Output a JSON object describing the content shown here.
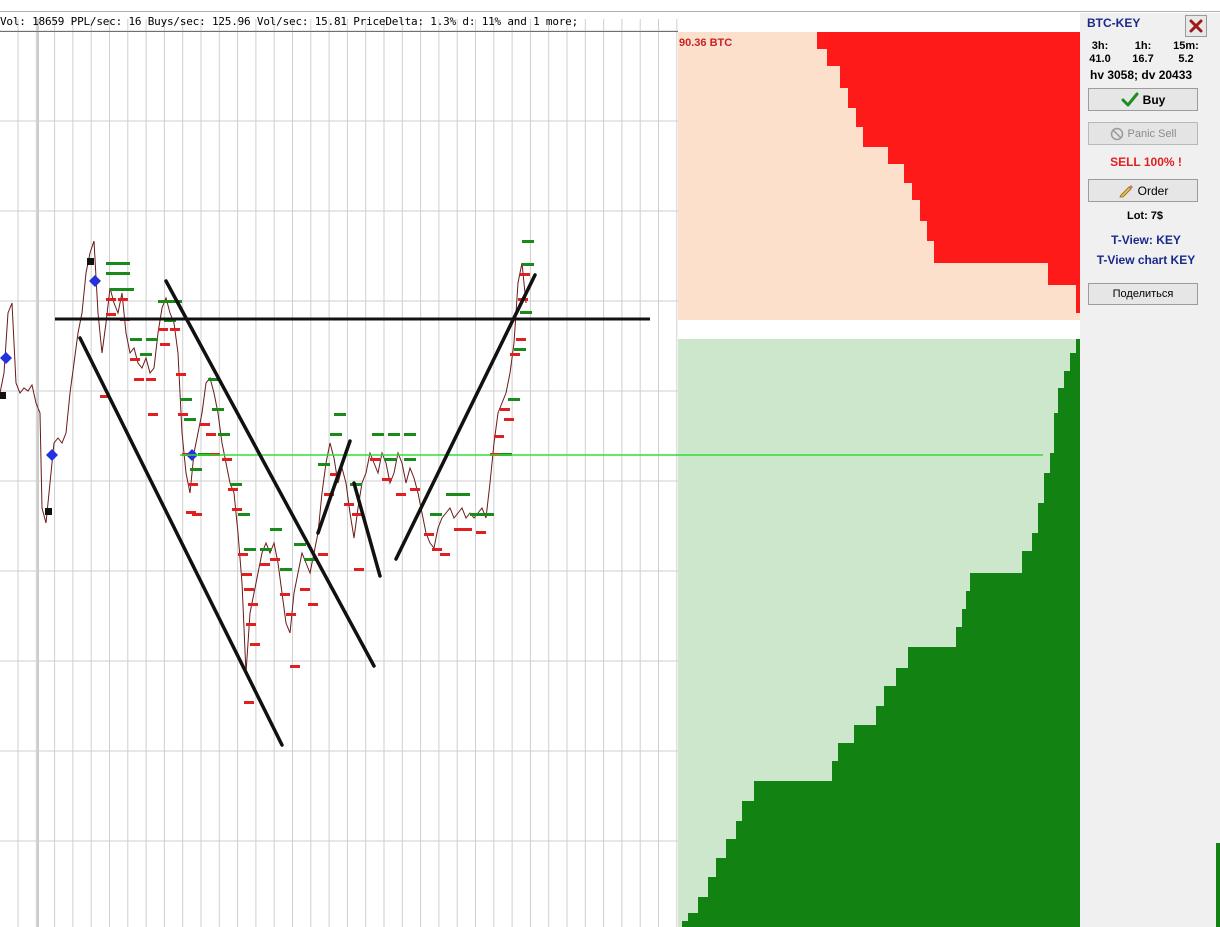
{
  "stats_line": "Vol: 18659 PPL/sec: 16  Buys/sec: 125.96 Vol/sec: 15.81 PriceDelta: 1.3%  d: 11% and 1 more;",
  "depth": {
    "volume_label": "90.36 BTC",
    "colors": {
      "ask_fill": "#ff1a1a",
      "ask_bg": "#fde0cc",
      "bid_fill": "#128212",
      "bid_bg": "#cde7cd"
    }
  },
  "panel": {
    "ticker": "BTC-KEY",
    "timeframes": [
      {
        "label": "3h:",
        "value": "41.0"
      },
      {
        "label": "1h:",
        "value": "16.7"
      },
      {
        "label": "15m:",
        "value": "5.2"
      }
    ],
    "hv_dv": "hv 3058; dv 20433",
    "buy_label": "Buy",
    "panic_sell_label": "Panic Sell",
    "sell_text": "SELL 100% !",
    "order_label": "Order",
    "lot_text": "Lot: 7$",
    "tview_link": "T-View: KEY",
    "tview_chart_link": "T-View chart KEY",
    "share_label": "Поделиться",
    "icons": {
      "close": "close-icon",
      "buy": "checkmark-icon",
      "panic": "block-icon",
      "order": "pencil-icon"
    }
  },
  "colors": {
    "accent_blue": "#1a2a8a",
    "sell_red": "#e02020",
    "level_line": "#33dd33"
  }
}
